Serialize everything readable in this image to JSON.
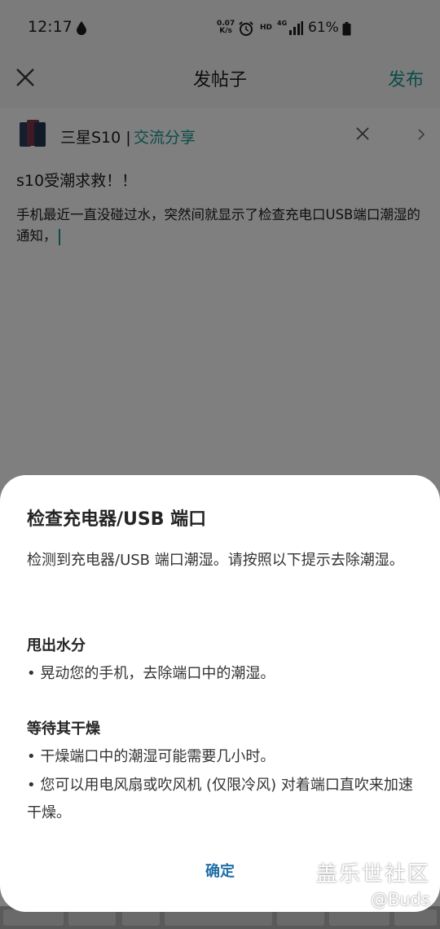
{
  "status_bar": {
    "time": "12:17",
    "net_speed_value": "0.07",
    "net_speed_unit": "K/s",
    "hd": "HD",
    "network": "4G",
    "battery": "61%"
  },
  "header": {
    "title": "发帖子",
    "publish_label": "发布"
  },
  "board": {
    "name": "三星S10 |",
    "category": "交流分享"
  },
  "post": {
    "title": "s10受潮求救！！",
    "body": "手机最近一直没碰过水，突然间就显示了检查充电口USB端口潮湿的通知，"
  },
  "dialog": {
    "title": "检查充电器/USB 端口",
    "description": "检测到充电器/USB 端口潮湿。请按照以下提示去除潮湿。",
    "section1_title": "甩出水分",
    "section1_item": "• 晃动您的手机，去除端口中的潮湿。",
    "section2_title": "等待其干燥",
    "section2_item1": "• 干燥端口中的潮湿可能需要几小时。",
    "section2_item2": "• 您可以用电风扇或吹风机 (仅限冷风) 对着端口直吹来加速干燥。",
    "confirm_label": "确定"
  },
  "watermark": {
    "line1": "盖乐世社区",
    "line2": "@Buds"
  },
  "colors": {
    "accent": "#169a95",
    "dialog_button": "#1f6fa8"
  }
}
